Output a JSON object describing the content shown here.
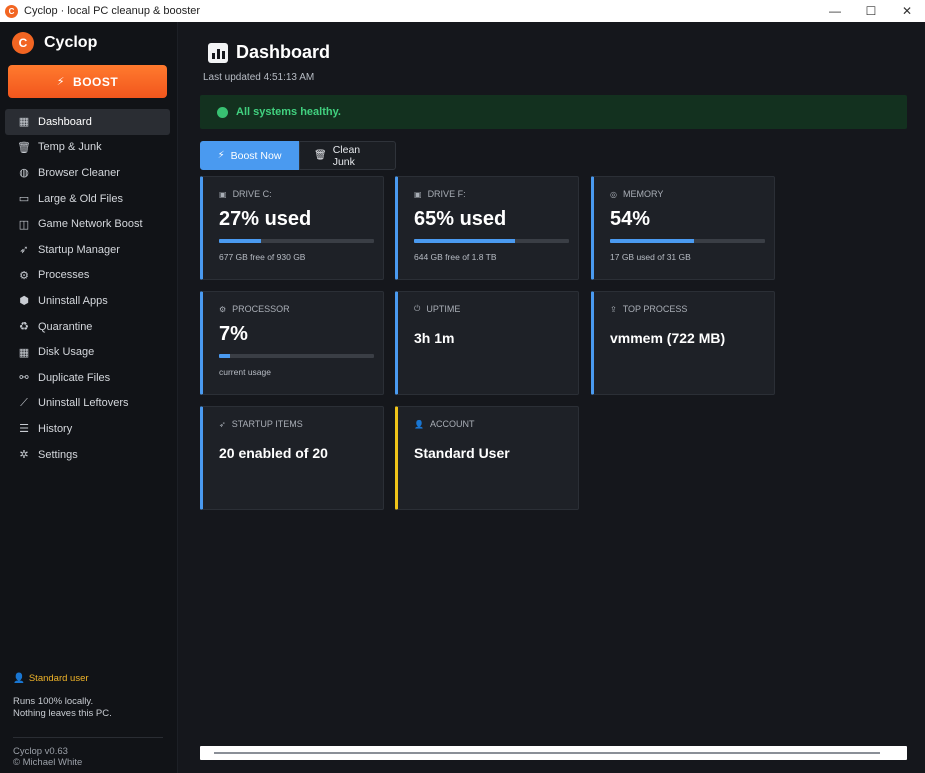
{
  "window": {
    "title": "Cyclop · local PC cleanup & booster",
    "app_icon": "C",
    "controls": {
      "minimize": "—",
      "maximize": "☐",
      "close": "✕"
    }
  },
  "sidebar": {
    "logo_letter": "C",
    "brand": "Cyclop",
    "boost_label": "BOOST",
    "items": [
      {
        "label": "Dashboard",
        "icon": "chart-icon",
        "glyph": "▦",
        "active": true
      },
      {
        "label": "Temp & Junk",
        "icon": "trash-icon",
        "glyph": "🗑"
      },
      {
        "label": "Browser Cleaner",
        "icon": "globe-icon",
        "glyph": "◍"
      },
      {
        "label": "Large & Old Files",
        "icon": "folder-icon",
        "glyph": "▭"
      },
      {
        "label": "Game Network Boost",
        "icon": "gamepad-icon",
        "glyph": "◫"
      },
      {
        "label": "Startup Manager",
        "icon": "rocket-icon",
        "glyph": "➶"
      },
      {
        "label": "Processes",
        "icon": "gear-icon",
        "glyph": "⚙"
      },
      {
        "label": "Uninstall Apps",
        "icon": "package-icon",
        "glyph": "⬢"
      },
      {
        "label": "Quarantine",
        "icon": "recycle-icon",
        "glyph": "♻"
      },
      {
        "label": "Disk Usage",
        "icon": "chart-bar-icon",
        "glyph": "▦"
      },
      {
        "label": "Duplicate Files",
        "icon": "link-icon",
        "glyph": "⚯"
      },
      {
        "label": "Uninstall Leftovers",
        "icon": "broom-icon",
        "glyph": "⟋"
      },
      {
        "label": "History",
        "icon": "list-icon",
        "glyph": "☰"
      },
      {
        "label": "Settings",
        "icon": "tools-icon",
        "glyph": "✲"
      }
    ],
    "user_label": "Standard user",
    "note_line1": "Runs 100% locally.",
    "note_line2": "Nothing leaves this PC.",
    "version": "Cyclop v0.63",
    "author": "© Michael White"
  },
  "main": {
    "title": "Dashboard",
    "last_updated": "Last updated 4:51:13 AM",
    "banner": "All systems healthy.",
    "actions": {
      "boost_now": "Boost Now",
      "clean_junk": "Clean Junk"
    },
    "cards": {
      "drive_c": {
        "label": "DRIVE C:",
        "value": "27% used",
        "sub": "677 GB free of 930 GB",
        "percent": 27
      },
      "drive_f": {
        "label": "DRIVE F:",
        "value": "65% used",
        "sub": "644 GB free of 1.8 TB",
        "percent": 65
      },
      "memory": {
        "label": "MEMORY",
        "value": "54%",
        "sub": "17 GB used of 31 GB",
        "percent": 54
      },
      "processor": {
        "label": "PROCESSOR",
        "value": "7%",
        "sub": "current usage",
        "percent": 7
      },
      "uptime": {
        "label": "UPTIME",
        "value": "3h 1m"
      },
      "top_process": {
        "label": "TOP PROCESS",
        "value": "vmmem  (722 MB)"
      },
      "startup": {
        "label": "STARTUP ITEMS",
        "value": "20 enabled of 20"
      },
      "account": {
        "label": "ACCOUNT",
        "value": "Standard User"
      }
    }
  },
  "colors": {
    "accent": "#4a9af0",
    "boost": "#f26522",
    "healthy": "#41d17f",
    "account_accent": "#f0c419"
  }
}
